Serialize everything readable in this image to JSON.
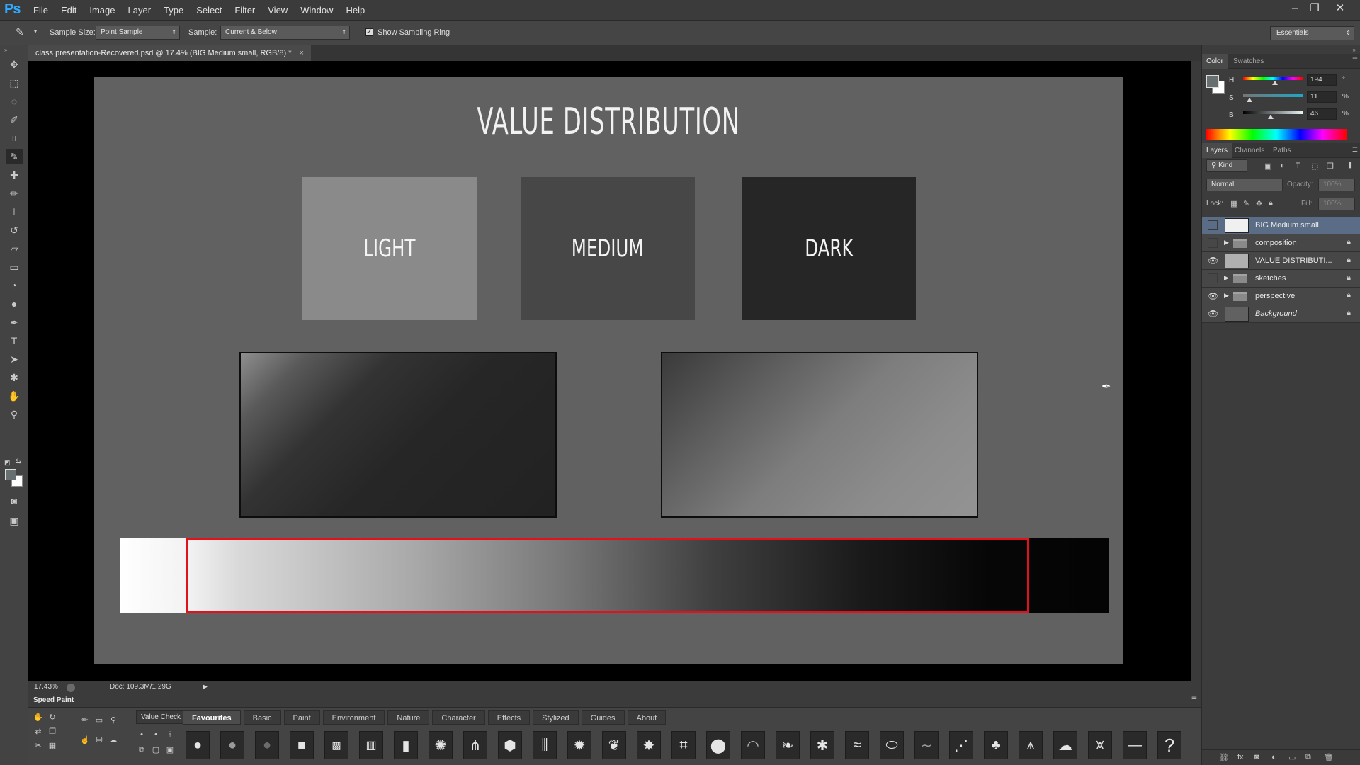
{
  "app": {
    "logo": "Ps",
    "menus": [
      "File",
      "Edit",
      "Image",
      "Layer",
      "Type",
      "Select",
      "Filter",
      "View",
      "Window",
      "Help"
    ]
  },
  "options": {
    "sample_size_label": "Sample Size:",
    "sample_size_value": "Point Sample",
    "sample_label": "Sample:",
    "sample_value": "Current & Below",
    "show_ring_label": "Show Sampling Ring",
    "workspace": "Essentials"
  },
  "document": {
    "tab_title": "class presentation-Recovered.psd @ 17.4% (BIG   Medium   small, RGB/8) *",
    "tab_close": "×",
    "zoom": "17.43%",
    "doc_size": "Doc: 109.3M/1.29G",
    "heading": "VALUE DISTRIBUTION",
    "swatches": [
      {
        "label": "LIGHT",
        "color": "#8a8a8a"
      },
      {
        "label": "MEDIUM",
        "color": "#474747"
      },
      {
        "label": "DARK",
        "color": "#262626"
      }
    ]
  },
  "color_panel": {
    "tabs": [
      "Color",
      "Swatches"
    ],
    "h_label": "H",
    "h_value": "194",
    "h_unit": "°",
    "s_label": "S",
    "s_value": "11",
    "s_unit": "%",
    "b_label": "B",
    "b_value": "46",
    "b_unit": "%",
    "h": 194,
    "s": 11,
    "b": 46,
    "foreground": "#686f71",
    "background": "#ffffff"
  },
  "layers_panel": {
    "tabs": [
      "Layers",
      "Channels",
      "Paths"
    ],
    "kind": "Kind",
    "blend_mode": "Normal",
    "opacity_label": "Opacity:",
    "opacity_value": "100%",
    "lock_label": "Lock:",
    "fill_label": "Fill:",
    "fill_value": "100%",
    "layers": [
      {
        "name": "BIG   Medium   small",
        "selected": true,
        "visible": false,
        "type": "layer",
        "locked": false
      },
      {
        "name": "composition",
        "selected": false,
        "visible": false,
        "type": "group",
        "locked": true
      },
      {
        "name": "VALUE DISTRIBUTI...",
        "selected": false,
        "visible": true,
        "type": "layer",
        "locked": true
      },
      {
        "name": "sketches",
        "selected": false,
        "visible": false,
        "type": "group",
        "locked": true
      },
      {
        "name": "perspective",
        "selected": false,
        "visible": true,
        "type": "group",
        "locked": true
      },
      {
        "name": "Background",
        "selected": false,
        "visible": true,
        "type": "background",
        "locked": true
      }
    ]
  },
  "speed_paint": {
    "title": "Speed Paint",
    "value_check": "Value Check",
    "tabs": [
      "Favourites",
      "Basic",
      "Paint",
      "Environment",
      "Nature",
      "Character",
      "Effects",
      "Stylized",
      "Guides",
      "About"
    ],
    "active_tab": "Favourites",
    "help": "?"
  },
  "accent_color": "#e2111b"
}
